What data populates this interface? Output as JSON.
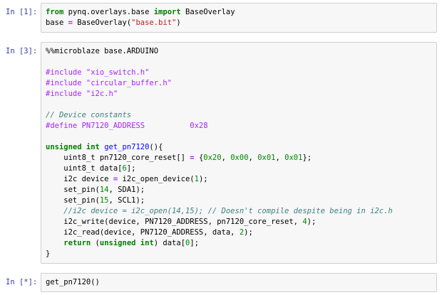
{
  "colors": {
    "prompt": "#303F9F",
    "cell_background": "#F7F7F7",
    "cell_border": "#CFCFCF",
    "keyword": "#008000",
    "operator": "#AA22FF",
    "meta": "#AA22FF",
    "number": "#008800",
    "comment": "#408080",
    "string": "#BA2121",
    "definition": "#0000FF"
  },
  "notebook": {
    "cells": [
      {
        "prompt": "In [1]:",
        "lines": [
          [
            [
              "kw",
              "from"
            ],
            [
              "pl",
              " pynq.overlays.base "
            ],
            [
              "kw",
              "import"
            ],
            [
              "pl",
              " BaseOverlay"
            ]
          ],
          [
            [
              "pl",
              "base "
            ],
            [
              "op",
              "="
            ],
            [
              "pl",
              " BaseOverlay("
            ],
            [
              "str",
              "\"base.bit\""
            ],
            [
              "pl",
              ")"
            ]
          ]
        ]
      },
      {
        "prompt": "In [3]:",
        "lines": [
          [
            [
              "pl",
              "%%microblaze base.ARDUINO"
            ]
          ],
          [],
          [
            [
              "meta",
              "#include \"xio_switch.h\""
            ]
          ],
          [
            [
              "meta",
              "#include \"circular_buffer.h\""
            ]
          ],
          [
            [
              "meta",
              "#include \"i2c.h\""
            ]
          ],
          [],
          [
            [
              "com",
              "// Device constants"
            ]
          ],
          [
            [
              "meta",
              "#define PN7120_ADDRESS          0x28"
            ]
          ],
          [],
          [
            [
              "kw",
              "unsigned"
            ],
            [
              "pl",
              " "
            ],
            [
              "kw",
              "int"
            ],
            [
              "pl",
              " "
            ],
            [
              "def",
              "get_pn7120"
            ],
            [
              "pl",
              "(){"
            ]
          ],
          [
            [
              "pl",
              "    uint8_t pn7120_core_reset[] "
            ],
            [
              "op",
              "="
            ],
            [
              "pl",
              " {"
            ],
            [
              "num",
              "0x20"
            ],
            [
              "pl",
              ", "
            ],
            [
              "num",
              "0x00"
            ],
            [
              "pl",
              ", "
            ],
            [
              "num",
              "0x01"
            ],
            [
              "pl",
              ", "
            ],
            [
              "num",
              "0x01"
            ],
            [
              "pl",
              "};"
            ]
          ],
          [
            [
              "pl",
              "    uint8_t data["
            ],
            [
              "num",
              "6"
            ],
            [
              "pl",
              "];"
            ]
          ],
          [
            [
              "pl",
              "    i2c device "
            ],
            [
              "op",
              "="
            ],
            [
              "pl",
              " i2c_open_device("
            ],
            [
              "num",
              "1"
            ],
            [
              "pl",
              ");"
            ]
          ],
          [
            [
              "pl",
              "    set_pin("
            ],
            [
              "num",
              "14"
            ],
            [
              "pl",
              ", SDA1);"
            ]
          ],
          [
            [
              "pl",
              "    set_pin("
            ],
            [
              "num",
              "15"
            ],
            [
              "pl",
              ", SCL1);"
            ]
          ],
          [
            [
              "com",
              "    //i2c device = i2c_open(14,15); // Doesn't compile despite being in i2c.h"
            ]
          ],
          [
            [
              "pl",
              "    i2c_write(device, PN7120_ADDRESS, pn7120_core_reset, "
            ],
            [
              "num",
              "4"
            ],
            [
              "pl",
              ");"
            ]
          ],
          [
            [
              "pl",
              "    i2c_read(device, PN7120_ADDRESS, data, "
            ],
            [
              "num",
              "2"
            ],
            [
              "pl",
              ");"
            ]
          ],
          [
            [
              "pl",
              "    "
            ],
            [
              "kw",
              "return"
            ],
            [
              "pl",
              " ("
            ],
            [
              "kw",
              "unsigned"
            ],
            [
              "pl",
              " "
            ],
            [
              "kw",
              "int"
            ],
            [
              "pl",
              ") data["
            ],
            [
              "num",
              "0"
            ],
            [
              "pl",
              "];"
            ]
          ],
          [
            [
              "pl",
              "}"
            ]
          ]
        ]
      },
      {
        "prompt": "In [*]:",
        "lines": [
          [
            [
              "pl",
              "get_pn7120()"
            ]
          ]
        ]
      }
    ]
  }
}
